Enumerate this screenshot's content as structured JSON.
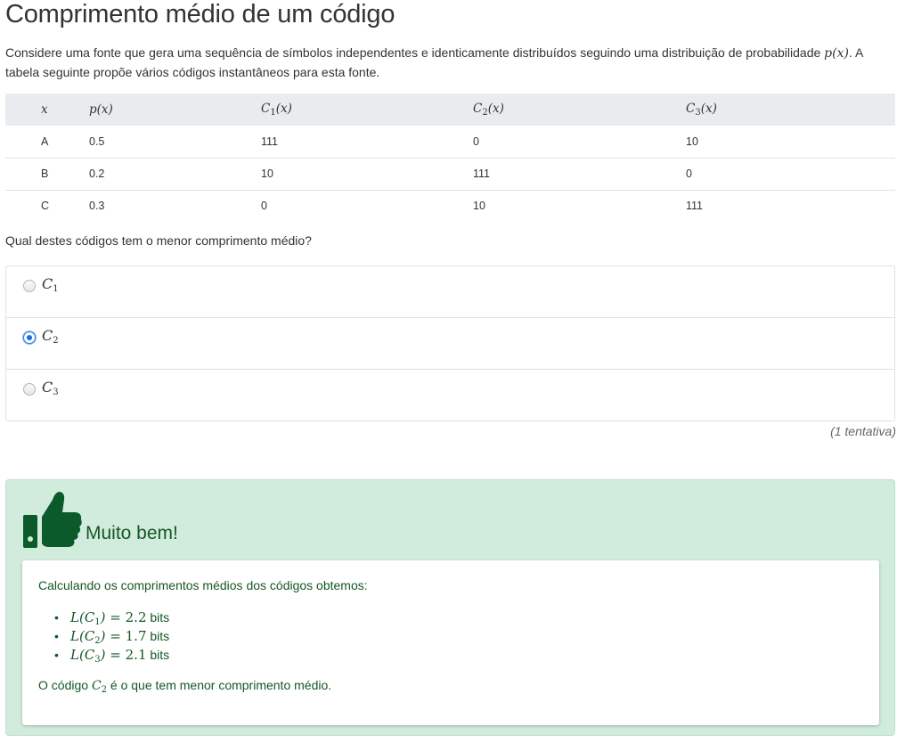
{
  "page": {
    "title": "Comprimento médio de um código",
    "intro_part1": "Considere uma fonte que gera uma sequência de símbolos independentes e identicamente distribuídos seguindo uma distribuição de probabilidade ",
    "intro_math": "p(x)",
    "intro_part2": ". A tabela seguinte propõe vários códigos instantâneos para esta fonte."
  },
  "table": {
    "headers": [
      "x",
      "p(x)",
      "C1(x)",
      "C2(x)",
      "C3(x)"
    ],
    "rows": [
      [
        "A",
        "0.5",
        "111",
        "0",
        "10"
      ],
      [
        "B",
        "0.2",
        "10",
        "111",
        "0"
      ],
      [
        "C",
        "0.3",
        "0",
        "10",
        "111"
      ]
    ]
  },
  "question": {
    "text": "Qual destes códigos tem o menor comprimento médio?",
    "options": [
      {
        "base": "C",
        "sub": "1",
        "selected": false
      },
      {
        "base": "C",
        "sub": "2",
        "selected": true
      },
      {
        "base": "C",
        "sub": "3",
        "selected": false
      }
    ],
    "attempts": "(1 tentativa)"
  },
  "feedback": {
    "icon": "thumbs-up-icon",
    "title": "Muito bem!",
    "intro": "Calculando os comprimentos médios dos códigos obtemos:",
    "results": [
      {
        "sub": "1",
        "value": "2.2",
        "unit": "bits"
      },
      {
        "sub": "2",
        "value": "1.7",
        "unit": "bits"
      },
      {
        "sub": "3",
        "value": "2.1",
        "unit": "bits"
      }
    ],
    "conclusion_prefix": "O código ",
    "conclusion_sub": "2",
    "conclusion_suffix": " é o que tem menor comprimento médio."
  },
  "colors": {
    "success_bg": "#d1ebdc",
    "success_text": "#155724",
    "thumb": "#0b5a2a",
    "radio_selected": "#1a6ddc"
  }
}
